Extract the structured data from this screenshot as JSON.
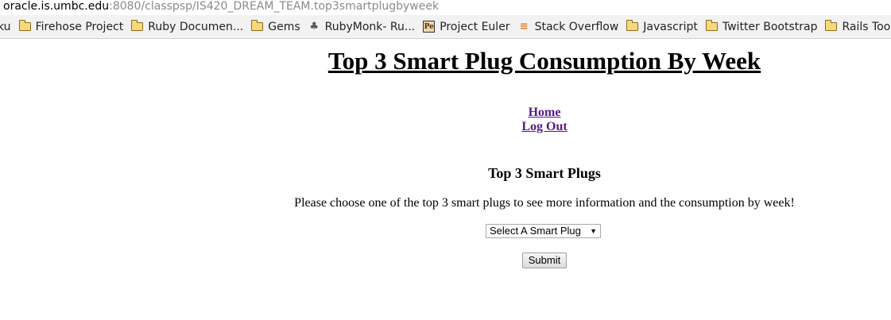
{
  "browser": {
    "url_host": "oracle.is.umbc.edu",
    "url_rest": ":8080/classpsp/IS420_DREAM_TEAM.top3smartplugbyweek",
    "bookmarks": [
      {
        "label": "ku",
        "icon": "none"
      },
      {
        "label": "Firehose Project",
        "icon": "folder-icon"
      },
      {
        "label": "Ruby Documen...",
        "icon": "folder-icon"
      },
      {
        "label": "Gems",
        "icon": "folder-icon"
      },
      {
        "label": "RubyMonk- Ru...",
        "icon": "rubymonk-icon"
      },
      {
        "label": "Project Euler",
        "icon": "project-euler-icon"
      },
      {
        "label": "Stack Overflow",
        "icon": "stack-overflow-icon"
      },
      {
        "label": "Javascript",
        "icon": "folder-icon"
      },
      {
        "label": "Twitter Bootstrap",
        "icon": "folder-icon"
      },
      {
        "label": "Rails Tools",
        "icon": "folder-icon"
      }
    ]
  },
  "page": {
    "title": "Top 3 Smart Plug Consumption By Week",
    "nav": {
      "home": "Home",
      "logout": "Log Out"
    },
    "section_title": "Top 3 Smart Plugs",
    "instructions": "Please choose one of the top 3 smart plugs to see more information and the consumption by week!",
    "select": {
      "selected": "Select A Smart Plug"
    },
    "submit_label": "Submit"
  },
  "colors": {
    "link_visited": "#551a8b",
    "bookmark_bar": "#f2f2f2",
    "url_gray": "#8a8a8a"
  }
}
